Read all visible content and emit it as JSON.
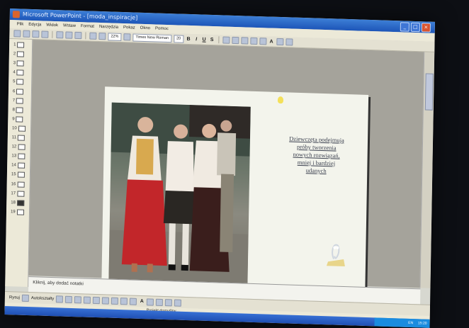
{
  "window": {
    "title": "Microsoft PowerPoint - [moda_inspiracje]"
  },
  "menu": [
    "Plik",
    "Edycja",
    "Widok",
    "Wstaw",
    "Format",
    "Narzędzia",
    "Pokaz",
    "Okno",
    "Pomoc"
  ],
  "toolbar": {
    "zoom": "22%",
    "font_name": "Times New Roman",
    "font_size": "20"
  },
  "slides_pane": {
    "numbers": [
      "1",
      "2",
      "3",
      "4",
      "5",
      "6",
      "7",
      "8",
      "9",
      "10",
      "11",
      "12",
      "13",
      "14",
      "15",
      "16",
      "17",
      "18",
      "19"
    ],
    "selected": "18"
  },
  "slide": {
    "caption_lines": [
      "Dziewczęta podejmują",
      "próby tworzenia",
      "nowych rozwiązań,",
      "mniej i bardziej",
      "udanych"
    ]
  },
  "notes": {
    "placeholder": "Kliknij, aby dodać notatki"
  },
  "drawbar": {
    "draw_label": "Rysuj",
    "autoshapes_label": "Autokształty"
  },
  "statusbar": {
    "design": "Projekt domyślny"
  },
  "tray": {
    "lang": "EN",
    "clock": "15:20"
  },
  "colors": {
    "titlebar": "#1d55b8",
    "slide_bg": "#f3f4ec",
    "caption": "#3c4150"
  }
}
